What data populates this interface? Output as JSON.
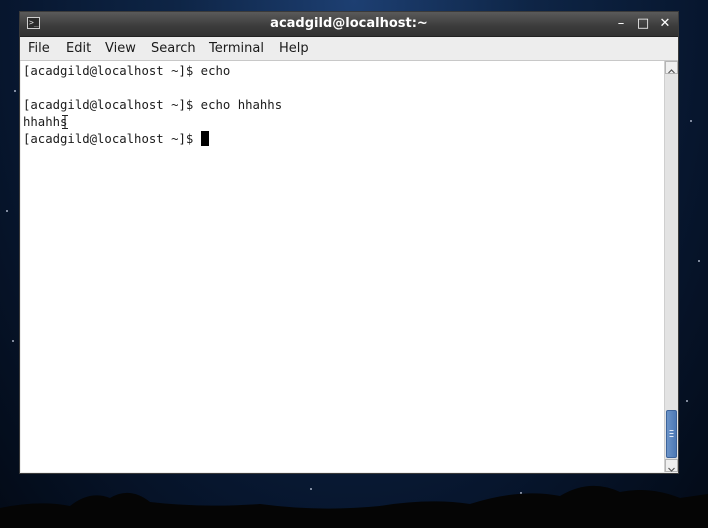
{
  "window": {
    "title": "acadgild@localhost:~",
    "controls": {
      "minimize": "–",
      "maximize": "□",
      "close": "✕"
    }
  },
  "menubar": {
    "items": [
      "File",
      "Edit",
      "View",
      "Search",
      "Terminal",
      "Help"
    ]
  },
  "terminal": {
    "lines": [
      "[acadgild@localhost ~]$ echo",
      "",
      "[acadgild@localhost ~]$ echo hhahhs",
      "hhahhs",
      "[acadgild@localhost ~]$ "
    ]
  },
  "colors": {
    "titlebar": "#3b3b3b",
    "scroll_thumb": "#4d79b5",
    "terminal_bg": "#ffffff",
    "terminal_fg": "#1b1b1b"
  },
  "icons": {
    "app": "terminal-icon",
    "scroll_up": "scroll-up-arrow-icon",
    "scroll_down": "scroll-down-arrow-icon"
  }
}
